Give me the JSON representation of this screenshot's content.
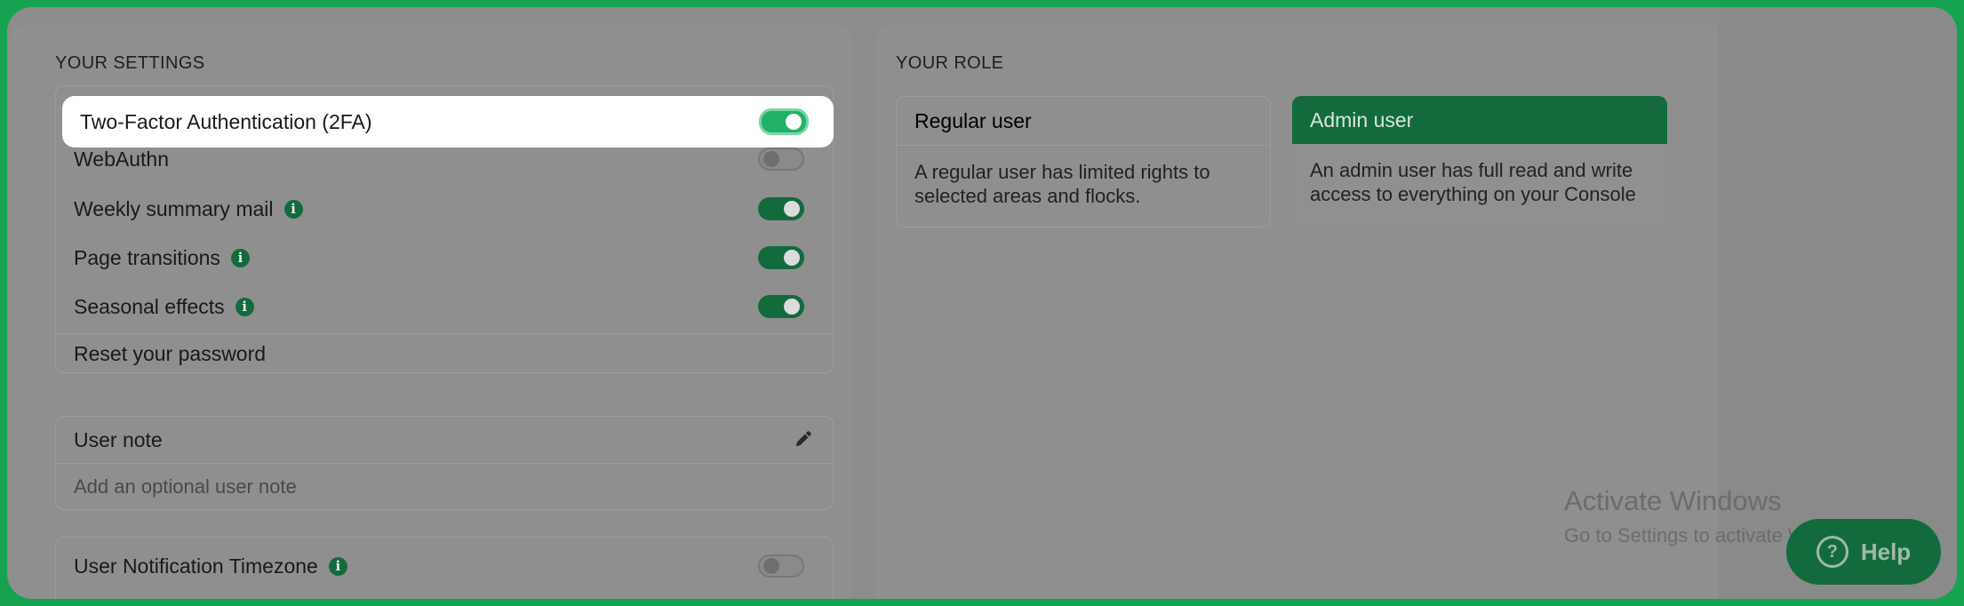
{
  "settings": {
    "title": "YOUR SETTINGS",
    "items": [
      {
        "label": "Two-Factor Authentication (2FA)",
        "enabled": true,
        "info": false
      },
      {
        "label": "WebAuthn",
        "enabled": false,
        "info": false
      },
      {
        "label": "Weekly summary mail",
        "enabled": true,
        "info": true
      },
      {
        "label": "Page transitions",
        "enabled": true,
        "info": true
      },
      {
        "label": "Seasonal effects",
        "enabled": true,
        "info": true
      }
    ],
    "reset_password": "Reset your password",
    "info_glyph": "i"
  },
  "user_note": {
    "title": "User note",
    "placeholder": "Add an optional user note"
  },
  "timezone": {
    "label": "User Notification Timezone",
    "enabled": false
  },
  "role": {
    "title": "YOUR ROLE",
    "options": [
      {
        "label": "Regular user",
        "description": "A regular user has limited rights to selected areas and flocks.",
        "selected": false
      },
      {
        "label": "Admin user",
        "description": "An admin user has full read and write access to everything on your Console",
        "selected": true
      }
    ]
  },
  "watermark": {
    "title": "Activate Windows",
    "subtitle": "Go to Settings to activate Windows."
  },
  "help_button": {
    "label": "Help",
    "icon_glyph": "?"
  },
  "colors": {
    "brand_green": "#136b3d",
    "frame_green": "#15a352",
    "toggle_highlight": "#21b167"
  }
}
